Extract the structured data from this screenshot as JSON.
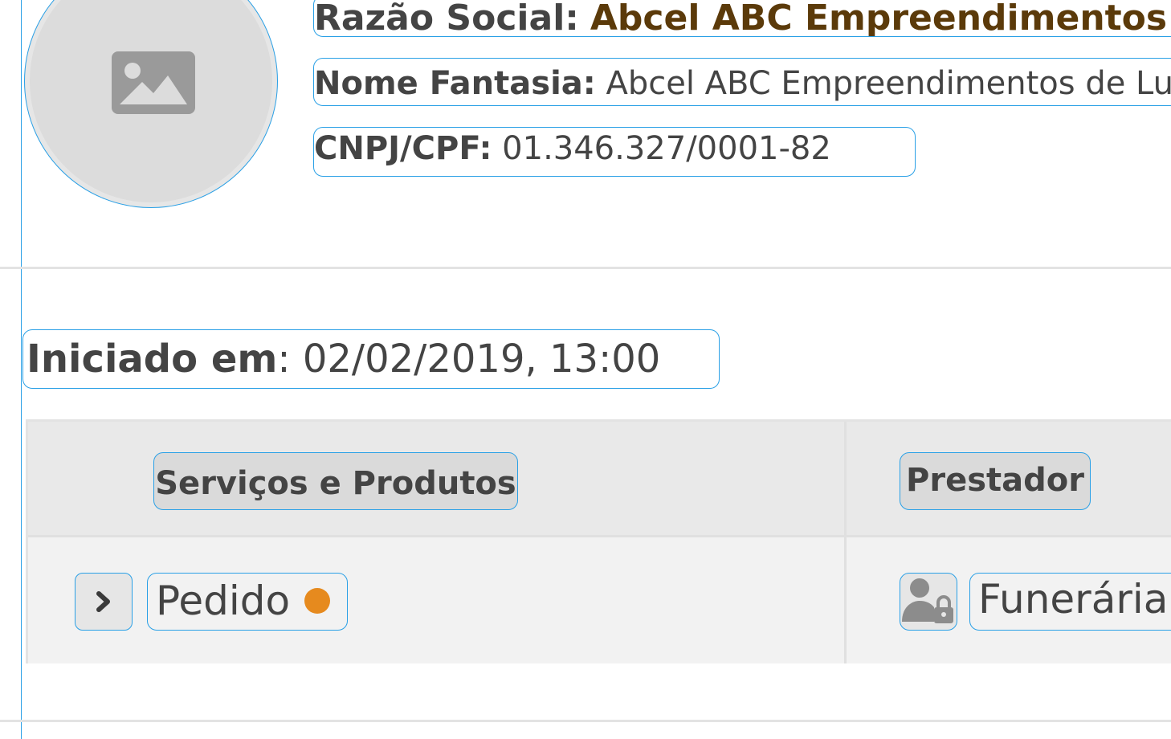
{
  "company": {
    "razao_social_label": "Razão Social:",
    "razao_social_value": "Abcel ABC Empreendimentos",
    "nome_fantasia_label": "Nome Fantasia:",
    "nome_fantasia_value": "Abcel ABC Empreendimentos de Lu",
    "cnpj_label": "CNPJ/CPF:",
    "cnpj_value": "01.346.327/0001-82",
    "avatar_icon": "image-placeholder-icon"
  },
  "session": {
    "iniciado_label": "Iniciado em",
    "iniciado_sep": ": ",
    "iniciado_value": "02/02/2019, 13:00"
  },
  "table": {
    "headers": [
      "Serviços e Produtos",
      "Prestador"
    ],
    "rows": [
      {
        "item": "Pedido",
        "status_color": "#e68a1e",
        "provider_icon": "user-lock-icon",
        "provider": "Funerária"
      }
    ]
  },
  "colors": {
    "accent_outline": "#2aa0e6",
    "brand_text": "#5b3a0a",
    "status_pending": "#e68a1e"
  }
}
